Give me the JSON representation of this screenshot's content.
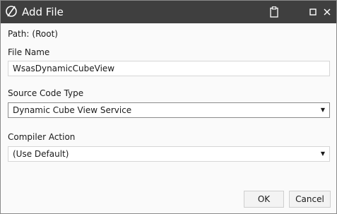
{
  "window": {
    "title": "Add File",
    "icon": "onestream-logo-icon",
    "controls": [
      "clipboard-icon",
      "maximize-icon",
      "close-icon"
    ]
  },
  "path": {
    "label": "Path:",
    "value": "(Root)"
  },
  "file_name": {
    "label": "File Name",
    "value": "WsasDynamicCubeView"
  },
  "source_code_type": {
    "label": "Source Code Type",
    "selected": "Dynamic Cube View Service"
  },
  "compiler_action": {
    "label": "Compiler Action",
    "selected": "(Use Default)"
  },
  "buttons": {
    "ok": "OK",
    "cancel": "Cancel"
  },
  "colors": {
    "titlebar": "#3f3f3f",
    "background": "#fafafa"
  }
}
